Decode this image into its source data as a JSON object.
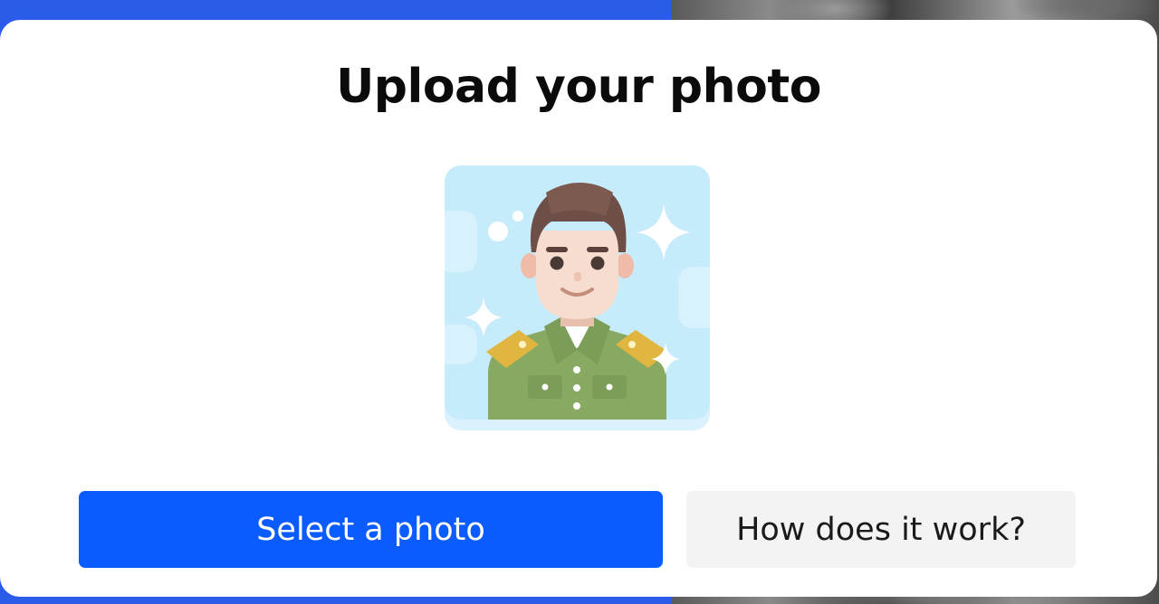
{
  "colors": {
    "backdrop_blue": "#2b5ce9",
    "primary_button": "#0a5cff",
    "primary_button_text": "#ffffff",
    "secondary_button": "#f3f3f3",
    "illustration_bg": "#c6ebfb"
  },
  "modal": {
    "title": "Upload your photo",
    "illustration_icon": "soldier-avatar-icon",
    "select_button_label": "Select a photo",
    "help_button_label": "How does it work?"
  }
}
